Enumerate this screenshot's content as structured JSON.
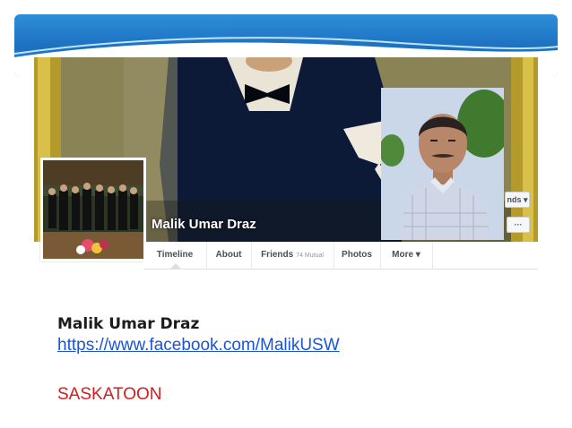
{
  "profile": {
    "name": "Malik Umar Draz",
    "cover_name": "Malik Umar Draz"
  },
  "cover_buttons": {
    "friends_label": "nds ▾",
    "more_label": "···"
  },
  "tabs": [
    {
      "label": "Timeline"
    },
    {
      "label": "About"
    },
    {
      "label": "Friends",
      "badge": "74 Mutual"
    },
    {
      "label": "Photos"
    },
    {
      "label": "More ▾"
    }
  ],
  "info": {
    "name": "Malik Umar Draz",
    "link": "https://www.facebook.com/MalikUSW",
    "city": "SASKATOON"
  },
  "colors": {
    "banner": "#1b6fbf",
    "link": "#1a55d9",
    "city": "#d41c1c"
  }
}
